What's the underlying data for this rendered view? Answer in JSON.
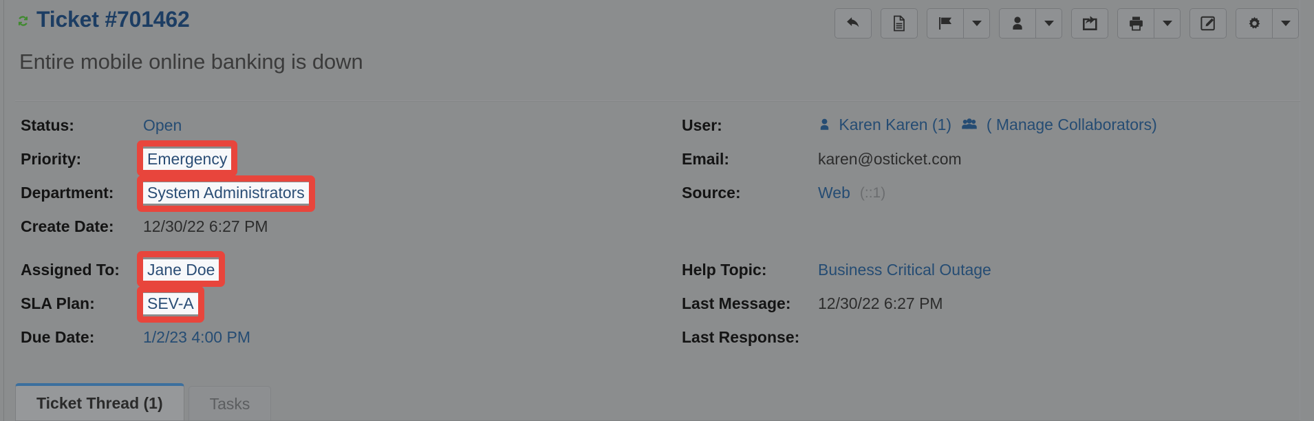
{
  "header": {
    "refresh_icon": "refresh-icon",
    "ticket_title": "Ticket #701462",
    "subject": "Entire mobile online banking is down"
  },
  "toolbar": {
    "buttons": [
      {
        "name": "reply-button",
        "icon": "reply-arrow-icon",
        "caret": false
      },
      {
        "name": "post-note-button",
        "icon": "document-icon",
        "caret": false
      },
      {
        "name": "flag-button",
        "icon": "flag-icon",
        "caret": true
      },
      {
        "name": "assign-user-button",
        "icon": "user-icon",
        "caret": true
      },
      {
        "name": "transfer-button",
        "icon": "share-arrow-icon",
        "caret": false
      },
      {
        "name": "print-button",
        "icon": "printer-icon",
        "caret": true
      },
      {
        "name": "edit-button",
        "icon": "edit-pencil-icon",
        "caret": false
      },
      {
        "name": "settings-button",
        "icon": "gear-icon",
        "caret": true
      }
    ]
  },
  "details": {
    "block_one": {
      "left": [
        {
          "label": "Status:",
          "value": "Open",
          "style": "link",
          "highlight": false
        },
        {
          "label": "Priority:",
          "value": "Emergency",
          "style": "link",
          "highlight": true
        },
        {
          "label": "Department:",
          "value": "System Administrators",
          "style": "link",
          "highlight": true
        },
        {
          "label": "Create Date:",
          "value": "12/30/22 6:27 PM",
          "style": "plain",
          "highlight": false
        }
      ],
      "right": [
        {
          "label": "User:",
          "value": "Karen Karen (1)",
          "style": "link",
          "icon": "user-icon",
          "suffix": "( Manage Collaborators)",
          "suffix_icon": "group-icon"
        },
        {
          "label": "Email:",
          "value": "karen@osticket.com",
          "style": "plain"
        },
        {
          "label": "Source:",
          "value": "Web",
          "style": "link",
          "muted": "(::1)"
        }
      ]
    },
    "block_two": {
      "left": [
        {
          "label": "Assigned To:",
          "value": "Jane Doe",
          "style": "link",
          "highlight": true
        },
        {
          "label": "SLA Plan:",
          "value": "SEV-A",
          "style": "link",
          "highlight": true
        },
        {
          "label": "Due Date:",
          "value": "1/2/23 4:00 PM",
          "style": "link",
          "highlight": false
        }
      ],
      "right": [
        {
          "label": "Help Topic:",
          "value": "Business Critical Outage",
          "style": "link"
        },
        {
          "label": "Last Message:",
          "value": "12/30/22 6:27 PM",
          "style": "plain"
        },
        {
          "label": "Last Response:",
          "value": "",
          "style": "plain"
        }
      ]
    }
  },
  "tabs": [
    {
      "label": "Ticket Thread (1)",
      "active": true
    },
    {
      "label": "Tasks",
      "active": false
    }
  ],
  "colors": {
    "page_overlay": "#8b8d8e",
    "title_blue": "#1c3d63",
    "link_blue": "#254c73",
    "highlight_red": "#e8453c",
    "highlight_bg": "#f7f8fa",
    "tab_active_top": "#3b6f9e"
  }
}
